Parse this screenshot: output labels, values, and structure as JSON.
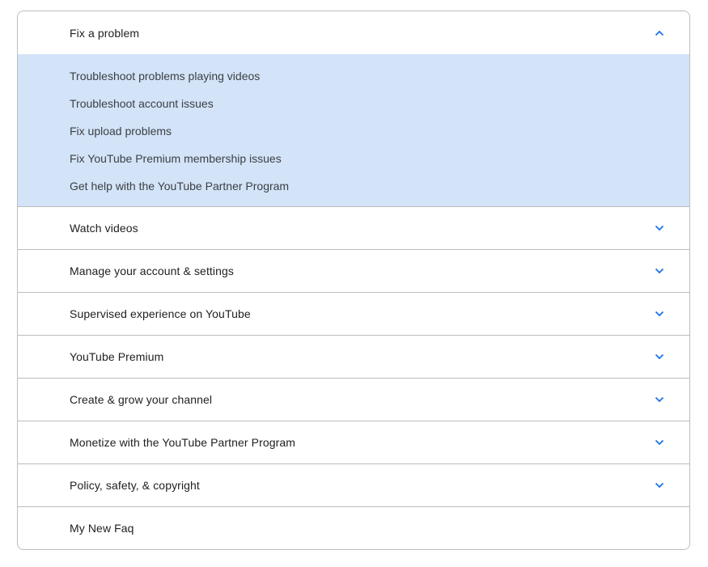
{
  "accordion": {
    "sections": [
      {
        "title": "Fix a problem",
        "expanded": true,
        "links": [
          "Troubleshoot problems playing videos",
          "Troubleshoot account issues",
          "Fix upload problems",
          "Fix YouTube Premium membership issues",
          "Get help with the YouTube Partner Program"
        ]
      },
      {
        "title": "Watch videos",
        "expanded": false
      },
      {
        "title": "Manage your account & settings",
        "expanded": false
      },
      {
        "title": "Supervised experience on YouTube",
        "expanded": false
      },
      {
        "title": "YouTube Premium",
        "expanded": false
      },
      {
        "title": "Create & grow your channel",
        "expanded": false
      },
      {
        "title": "Monetize with the YouTube Partner Program",
        "expanded": false
      },
      {
        "title": "Policy, safety, & copyright",
        "expanded": false
      },
      {
        "title": "My New Faq",
        "expanded": false
      }
    ]
  },
  "colors": {
    "accent": "#1a73e8",
    "panel_background": "#d3e3f8",
    "border": "#bdbdbd"
  },
  "icons": {
    "expanded": "chevron-up-icon",
    "collapsed": "chevron-down-icon"
  }
}
